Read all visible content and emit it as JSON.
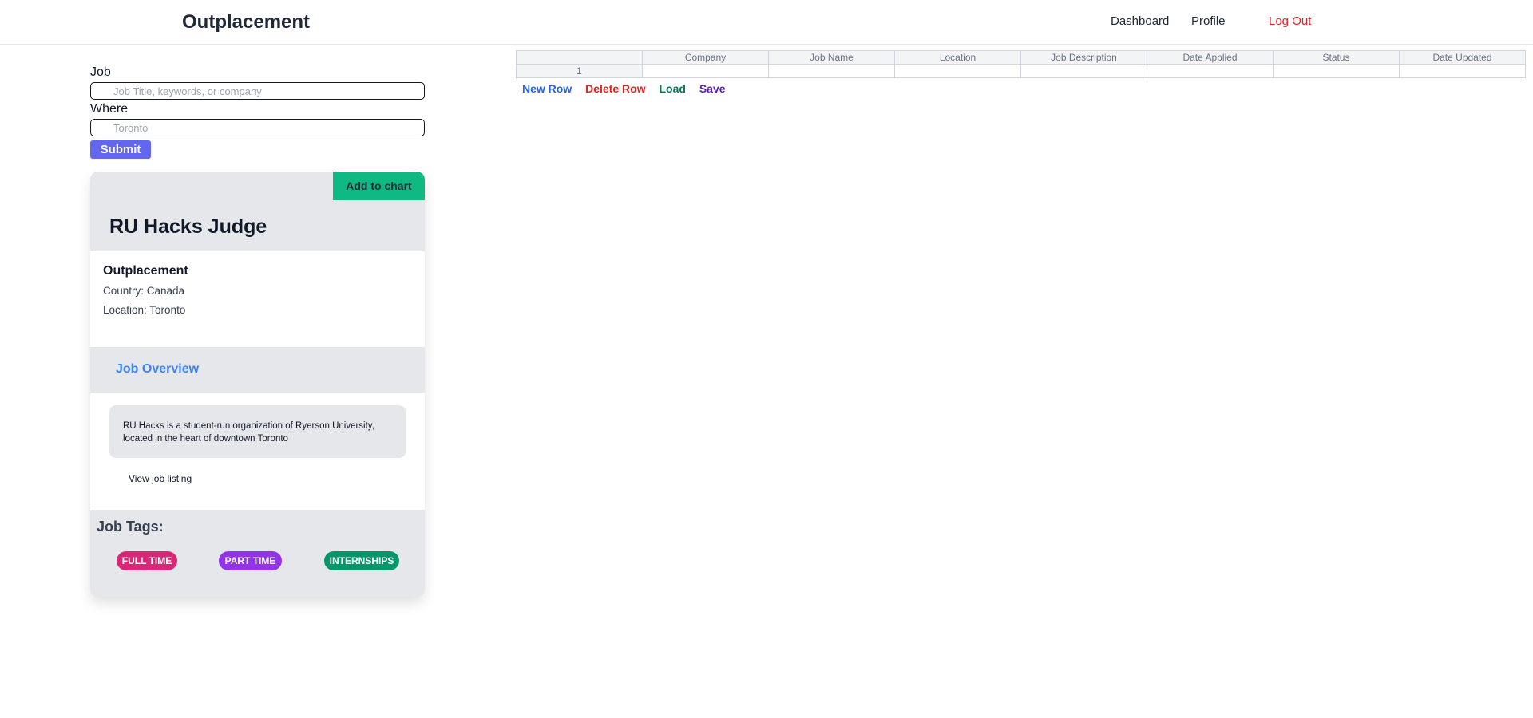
{
  "header": {
    "brand": "Outplacement",
    "nav": {
      "dashboard": "Dashboard",
      "profile": "Profile",
      "logout": "Log Out"
    }
  },
  "search": {
    "job_label": "Job",
    "job_placeholder": "Job Title, keywords, or company",
    "where_label": "Where",
    "where_placeholder": "Toronto",
    "submit_label": "Submit"
  },
  "job_card": {
    "add_label": "Add to chart",
    "title": "RU Hacks Judge",
    "company": "Outplacement",
    "country": "Country: Canada",
    "location": "Location: Toronto",
    "overview_label": "Job Overview",
    "description": "RU Hacks is a student-run organization of Ryerson University, located in the heart of downtown Toronto",
    "view_link": "View job listing",
    "tags_label": "Job Tags:",
    "tags": [
      "FULL TIME",
      "PART TIME",
      "INTERNSHIPS"
    ]
  },
  "spreadsheet": {
    "columns": [
      "",
      "Company",
      "Job Name",
      "Location",
      "Job Description",
      "Date Applied",
      "Status",
      "Date Updated"
    ],
    "rows": [
      [
        "1",
        "",
        "",
        "",
        "",
        "",
        "",
        ""
      ]
    ],
    "actions": {
      "new_row": "New Row",
      "delete_row": "Delete Row",
      "load": "Load",
      "save": "Save"
    }
  },
  "colors": {
    "accent": "#6366f1",
    "add_button": "#10b981",
    "logout": "#dc2626",
    "overview": "#3b82f6",
    "tag_fulltime": "#db2777",
    "tag_parttime": "#9333ea",
    "tag_internships": "#059669"
  }
}
